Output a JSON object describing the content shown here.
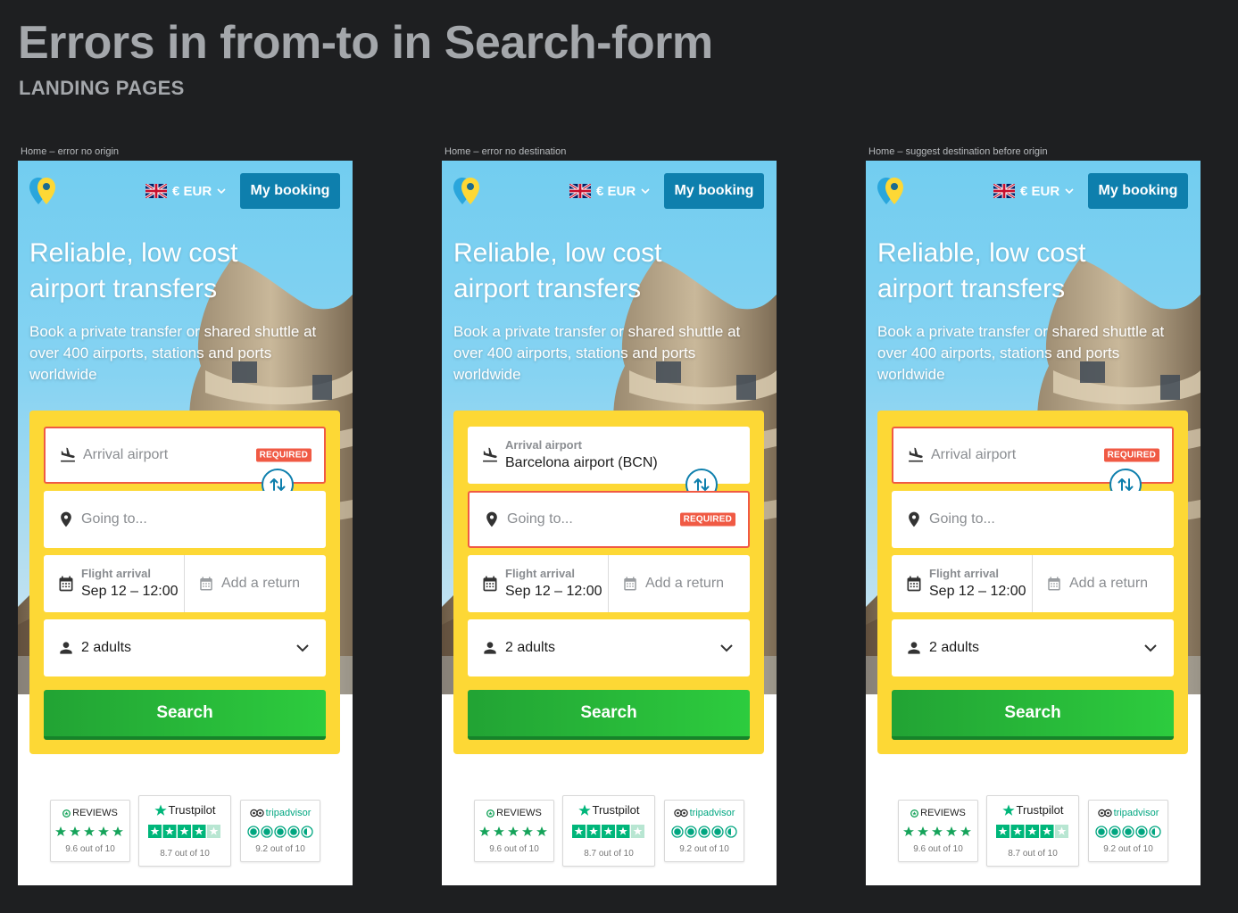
{
  "page": {
    "title": "Errors in from-to in Search-form",
    "subtitle": "LANDING PAGES"
  },
  "frames": [
    {
      "label": "Home – error no origin",
      "origin_error": true,
      "destination_error": false,
      "origin_filled": false
    },
    {
      "label": "Home – error no destination",
      "origin_error": false,
      "destination_error": true,
      "origin_filled": true
    },
    {
      "label": "Home – suggest destination before origin",
      "origin_error": true,
      "destination_error": false,
      "origin_filled": false
    }
  ],
  "header": {
    "currency": "€ EUR",
    "my_booking": "My booking"
  },
  "hero": {
    "headline": "Reliable, low cost airport transfers",
    "subline": "Book a private transfer or shared shuttle at over 400 airports, stations and ports worldwide"
  },
  "form": {
    "origin_placeholder": "Arrival airport",
    "origin_label": "Arrival airport",
    "origin_value": "Barcelona airport (BCN)",
    "destination_placeholder": "Going to...",
    "required_badge": "REQUIRED",
    "date_label": "Flight arrival",
    "date_value": "Sep 12 – 12:00",
    "return_placeholder": "Add a return",
    "passengers": "2 adults",
    "search_label": "Search"
  },
  "reviews": [
    {
      "name": "REVIEWS",
      "score": "9.6 out of 10"
    },
    {
      "name": "Trustpilot",
      "score": "8.7 out of 10"
    },
    {
      "name": "tripadvisor",
      "score": "9.2 out of 10"
    }
  ],
  "colors": {
    "background": "#1e1f21",
    "primary_blue": "#0e7fad",
    "form_yellow": "#fdd835",
    "error_red": "#f05a44",
    "search_green": "#2dcc3e"
  }
}
